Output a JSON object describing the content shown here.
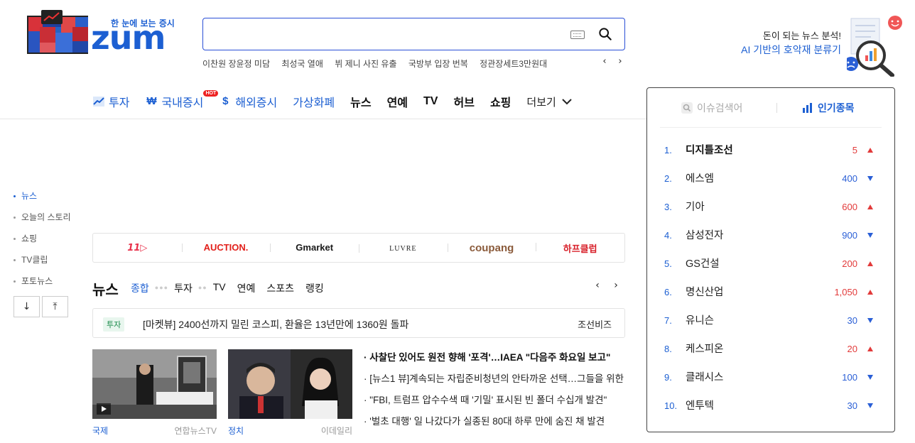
{
  "logo": {
    "tagline": "한 눈에 보는 증시",
    "wordmark": "zum"
  },
  "search": {
    "value": "",
    "placeholder": ""
  },
  "trending": [
    "이찬원 장윤정 미담",
    "최성국 열애",
    "뷔 제니 사진 유출",
    "국방부 입장 번복",
    "정관장세트3만원대"
  ],
  "promo": {
    "line1": "돈이 되는 뉴스 분석!",
    "line2": "AI 기반의 호악재 분류기"
  },
  "gnb": {
    "invest": "투자",
    "domestic": "국내증시",
    "hot": "HOT",
    "overseas": "해외증시",
    "crypto": "가상화폐",
    "news": "뉴스",
    "entertain": "연예",
    "tv": "TV",
    "hub": "허브",
    "shopping": "쇼핑",
    "more": "더보기"
  },
  "quick": [
    "뉴스",
    "오늘의 스토리",
    "쇼핑",
    "TV클립",
    "포토뉴스"
  ],
  "shops": [
    {
      "name": "11",
      "color": "#e8304a"
    },
    {
      "name": "AUCTION.",
      "color": "#e2201b"
    },
    {
      "name": "Gmarket",
      "color": "#1a1a1a"
    },
    {
      "name": "LUVRE",
      "color": "#222222"
    },
    {
      "name": "coupang",
      "color": "#8a5a3a"
    },
    {
      "name": "하프클럽",
      "color": "#d8202a"
    }
  ],
  "news": {
    "title": "뉴스",
    "tabs": [
      "종합",
      "투자",
      "TV",
      "연예",
      "스포츠",
      "랭킹"
    ],
    "ticker": {
      "badge": "투자",
      "headline": "[마켓뷰] 2400선까지 밀린 코스피, 환율은 13년만에 1360원 돌파",
      "source": "조선비즈"
    },
    "thumbs": [
      {
        "category": "국제",
        "source": "연합뉴스TV"
      },
      {
        "category": "정치",
        "source": "이데일리"
      }
    ],
    "headlines": [
      "· 사찰단 있어도 원전 향해 '포격'…IAEA \"다음주 화요일 보고\"",
      "· [뉴스1 뷰]계속되는 자립준비청년의 안타까운 선택…그들을 위한",
      "· \"FBI, 트럼프 압수수색 때 '기밀' 표시된 빈 폴더 수십개 발견\"",
      "· '벌초 대행' 일 나갔다가 실종된 80대 하루 만에 숨진 채 발견"
    ]
  },
  "ranking": {
    "tab_issue": "이슈검색어",
    "tab_stock": "인기종목",
    "items": [
      {
        "rank": "1.",
        "name": "디지틀조선",
        "change": "5",
        "dir": "up"
      },
      {
        "rank": "2.",
        "name": "에스엠",
        "change": "400",
        "dir": "down"
      },
      {
        "rank": "3.",
        "name": "기아",
        "change": "600",
        "dir": "up"
      },
      {
        "rank": "4.",
        "name": "삼성전자",
        "change": "900",
        "dir": "down"
      },
      {
        "rank": "5.",
        "name": "GS건설",
        "change": "200",
        "dir": "up"
      },
      {
        "rank": "6.",
        "name": "명신산업",
        "change": "1,050",
        "dir": "up"
      },
      {
        "rank": "7.",
        "name": "유니슨",
        "change": "30",
        "dir": "down"
      },
      {
        "rank": "8.",
        "name": "케스피온",
        "change": "20",
        "dir": "up"
      },
      {
        "rank": "9.",
        "name": "클래시스",
        "change": "100",
        "dir": "down"
      },
      {
        "rank": "10.",
        "name": "엔투텍",
        "change": "30",
        "dir": "down"
      }
    ]
  },
  "colors": {
    "brand": "#1c5fd2",
    "up": "#e23a3a",
    "down": "#2a5fd6"
  }
}
